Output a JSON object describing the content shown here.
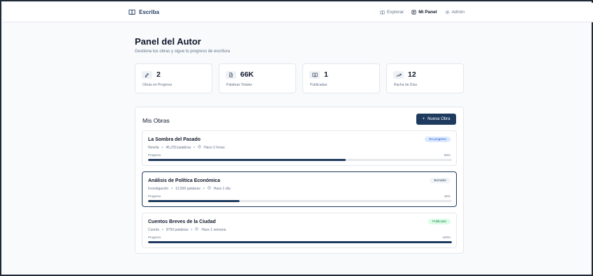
{
  "nav": {
    "brand": "Escriba",
    "links": [
      {
        "label": "Explorar"
      },
      {
        "label": "Mi Panel"
      },
      {
        "label": "Admin"
      }
    ]
  },
  "header": {
    "title": "Panel del Autor",
    "subtitle": "Gestiona tus obras y sigue tu progreso de escritura"
  },
  "stats": [
    {
      "value": "2",
      "label": "Obras en Progreso",
      "icon": "pen-icon"
    },
    {
      "value": "66K",
      "label": "Palabras Totales",
      "icon": "document-icon"
    },
    {
      "value": "1",
      "label": "Publicadas",
      "icon": "book-icon"
    },
    {
      "value": "12",
      "label": "Racha de Días",
      "icon": "trending-up-icon"
    }
  ],
  "works": {
    "title": "Mis Obras",
    "new_button": "Nueva Obra",
    "items": [
      {
        "title": "La Sombra del Pasado",
        "genre": "Novela",
        "words": "45,230 palabras",
        "updated": "Hace 2 horas",
        "status": "En progreso",
        "progress_label": "Progreso",
        "progress_text": "65%",
        "progress": 65
      },
      {
        "title": "Análisis de Política Económica",
        "genre": "Investigación",
        "words": "12,500 palabras",
        "updated": "Hace 1 día",
        "status": "Borrador",
        "progress_label": "Progreso",
        "progress_text": "30%",
        "progress": 30
      },
      {
        "title": "Cuentos Breves de la Ciudad",
        "genre": "Cuento",
        "words": "8750 palabras",
        "updated": "Hace 1 semana",
        "status": "Publicado",
        "progress_label": "Progreso",
        "progress_text": "100%",
        "progress": 100
      }
    ]
  },
  "colors": {
    "primary": "#1e3a5f",
    "muted": "#64748b",
    "border": "#e5e7eb"
  }
}
